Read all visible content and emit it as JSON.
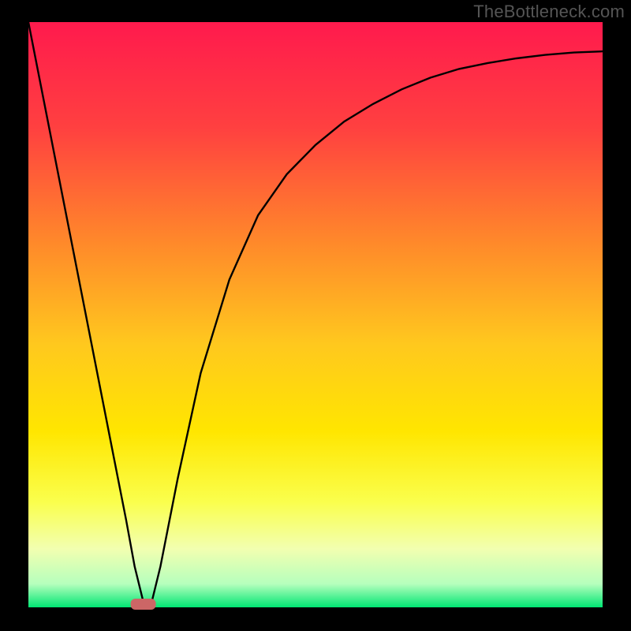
{
  "watermark": "TheBottleneck.com",
  "chart_data": {
    "type": "line",
    "title": "",
    "xlabel": "",
    "ylabel": "",
    "xlim": [
      0,
      100
    ],
    "ylim": [
      0,
      100
    ],
    "grid": false,
    "background_gradient": [
      "#ff1a4d",
      "#ff5e33",
      "#ffb020",
      "#ffe600",
      "#ffff55",
      "#f7ffb3",
      "#00e673"
    ],
    "series": [
      {
        "name": "curve",
        "x": [
          0,
          5,
          10,
          15,
          17,
          18.5,
          20,
          21.5,
          23,
          26,
          30,
          35,
          40,
          45,
          50,
          55,
          60,
          65,
          70,
          75,
          80,
          85,
          90,
          95,
          100
        ],
        "values": [
          100,
          75,
          50,
          25,
          15,
          7,
          1,
          1,
          7,
          22,
          40,
          56,
          67,
          74,
          79,
          83,
          86,
          88.5,
          90.5,
          92,
          93,
          93.8,
          94.4,
          94.8,
          95
        ]
      }
    ],
    "marker": {
      "name": "highlight",
      "x": 20,
      "y": 0,
      "color": "#cc6666",
      "shape": "rounded-rect"
    }
  }
}
